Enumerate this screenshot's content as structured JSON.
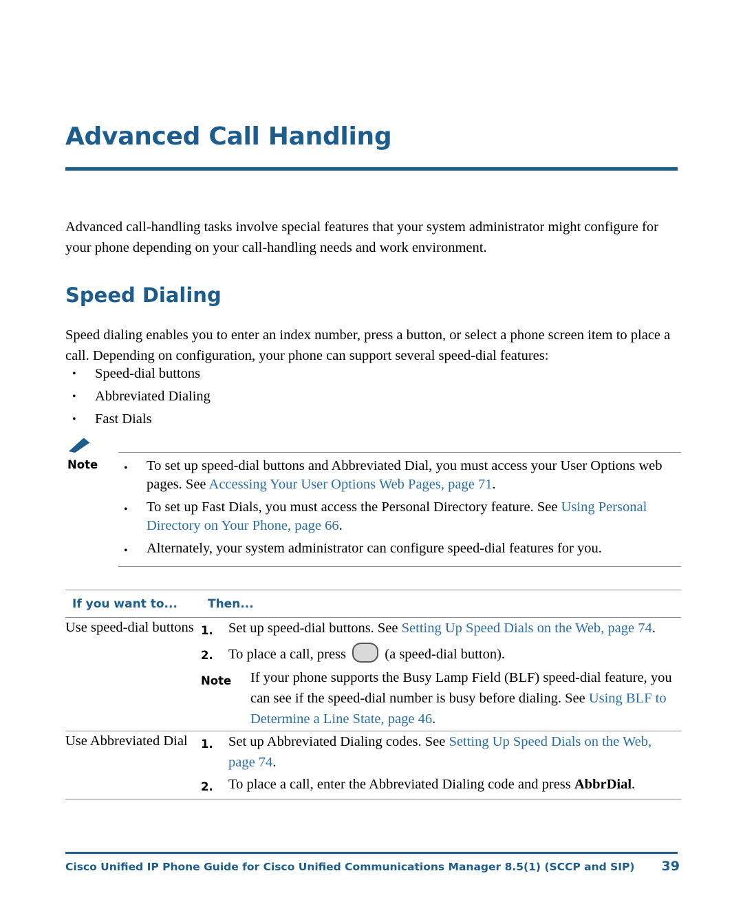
{
  "chapter": {
    "title": "Advanced Call Handling",
    "intro": "Advanced call-handling tasks involve special features that your system administrator might configure for your phone depending on your call-handling needs and work environment."
  },
  "section": {
    "title": "Speed Dialing",
    "body": "Speed dialing enables you to enter an index number, press a button, or select a phone screen item to place a call. Depending on configuration, your phone can support several speed-dial features:",
    "bullets": [
      "Speed-dial buttons",
      "Abbreviated Dialing",
      "Fast Dials"
    ]
  },
  "note": {
    "label": "Note",
    "icon": "pencil-note-icon",
    "items": [
      {
        "pre": "To set up speed-dial buttons and Abbreviated Dial, you must access your User Options web pages. See ",
        "link": "Accessing Your User Options Web Pages, page 71",
        "post": "."
      },
      {
        "pre": "To set up Fast Dials, you must access the Personal Directory feature. See ",
        "link": "Using Personal Directory on Your Phone, page 66",
        "post": "."
      },
      {
        "pre": "Alternately, your system administrator can configure speed-dial features for you.",
        "link": "",
        "post": ""
      }
    ]
  },
  "table": {
    "headers": [
      "If you want to...",
      "Then..."
    ],
    "rows": [
      {
        "task": "Use speed-dial buttons",
        "steps": [
          {
            "num": "1.",
            "pre": "Set up speed-dial buttons. See ",
            "link": "Setting Up Speed Dials on the Web, page 74",
            "post": "."
          },
          {
            "num": "2.",
            "pre": "To place a call, press ",
            "icon": "speed-dial-button-icon",
            "post": " (a speed-dial button)."
          },
          {
            "num": "Note",
            "pre": "If your phone supports the Busy Lamp Field (BLF) speed-dial feature, you can see if the speed-dial number is busy before dialing. See ",
            "link": "Using BLF to Determine a Line State, page 46",
            "post": "."
          }
        ]
      },
      {
        "task": "Use Abbreviated Dial",
        "steps": [
          {
            "num": "1.",
            "pre": "Set up Abbreviated Dialing codes. See ",
            "link": "Setting Up Speed Dials on the Web, page 74",
            "post": "."
          },
          {
            "num": "2.",
            "pre": "To place a call, enter the Abbreviated Dialing code and press ",
            "bold": "AbbrDial",
            "post": "."
          }
        ]
      }
    ]
  },
  "footer": {
    "text": "Cisco Unified IP Phone Guide for Cisco Unified Communications Manager 8.5(1) (SCCP and SIP)",
    "page": "39"
  },
  "colors": {
    "accent": "#1d5d8e",
    "link": "#2a6ea8",
    "rule": "#8a8a8a"
  }
}
